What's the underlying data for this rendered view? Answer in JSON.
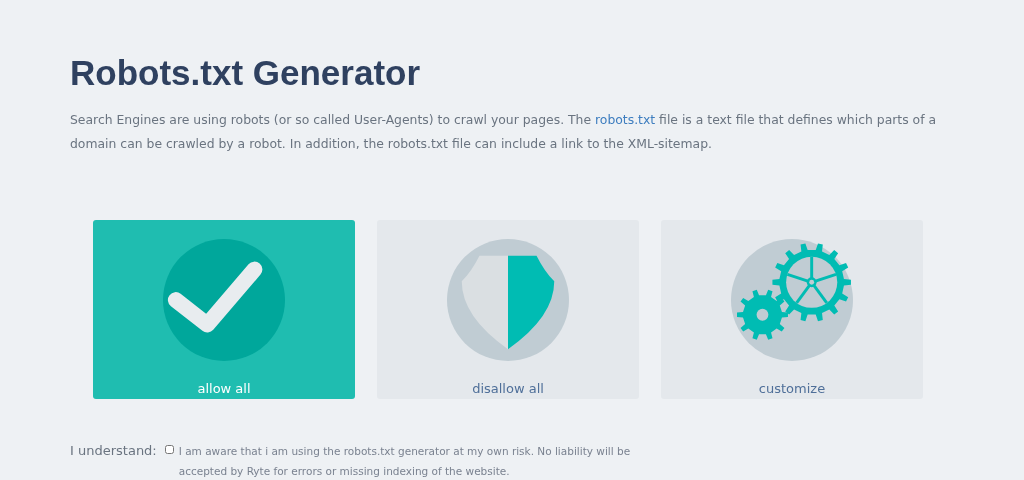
{
  "title": "Robots.txt Generator",
  "intro": {
    "before": "Search Engines are using robots (or so called User-Agents) to crawl your pages. The",
    "link": "robots.txt",
    "after": "file is a text file that defines which parts of a domain can be crawled by a robot. In addition, the robots.txt file can include a link to the XML-sitemap."
  },
  "options": [
    {
      "kind": "allow",
      "label": "allow all",
      "selected": true
    },
    {
      "kind": "disallow",
      "label": "disallow all",
      "selected": false
    },
    {
      "kind": "customize",
      "label": "customize",
      "selected": false
    }
  ],
  "consent": {
    "label": "I understand:",
    "checked": false,
    "text": "I am aware that i am using the robots.txt generator at my own risk. No liability will be accepted by Ryte for errors or missing indexing of the website."
  }
}
